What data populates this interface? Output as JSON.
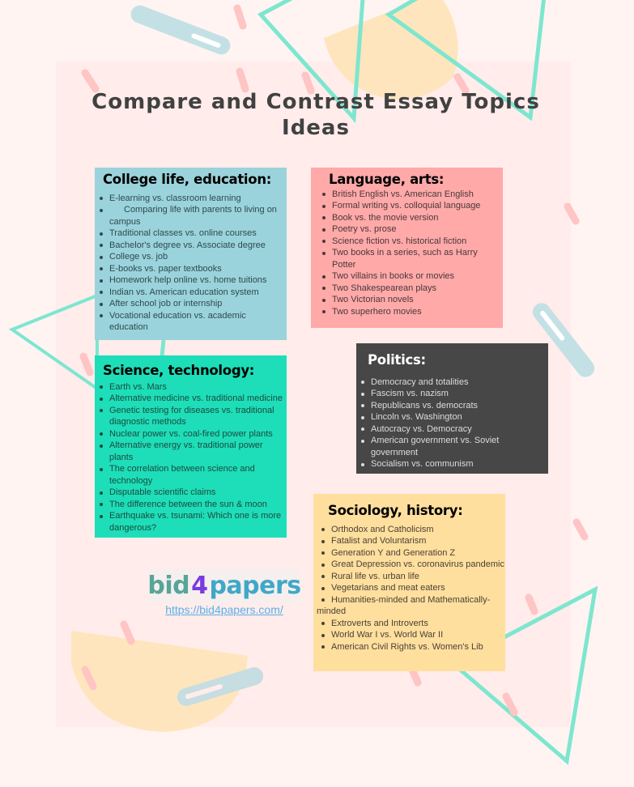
{
  "title": "Compare and Contrast Essay Topics Ideas",
  "colors": {
    "background": "#fff4f2",
    "panel": "#ffeceb",
    "college_card": "#9ad3db",
    "language_card": "#ffa9a9",
    "science_card": "#1ddeb8",
    "politics_card": "#474747",
    "sociology_card": "#ffdf9e",
    "accent_teal": "#7de6cf",
    "accent_pink": "#ffc4c4",
    "accent_yellow": "#ffe5bd",
    "accent_blue": "#c3e1e4"
  },
  "cards": {
    "college": {
      "heading": "College life, education:",
      "items": [
        "E-learning vs. classroom learning",
        "Comparing life with parents to living on campus",
        "Traditional classes vs. online courses",
        "Bachelor's degree vs. Associate degree",
        "College vs. job",
        "E-books vs. paper textbooks",
        "Homework help online vs. home tuitions",
        "Indian vs. American education system",
        "After school job or internship",
        "Vocational education vs. academic education"
      ]
    },
    "language": {
      "heading": "Language, arts:",
      "items": [
        "British English vs. American English",
        "Formal writing vs. colloquial language",
        "Book vs. the movie version",
        "Poetry vs. prose",
        "Science fiction vs. historical fiction",
        "Two books in a series, such as Harry Potter",
        "Two villains in books or movies",
        "Two Shakespearean plays",
        "Two Victorian novels",
        "Two superhero movies"
      ]
    },
    "science": {
      "heading": "Science, technology:",
      "items": [
        "Earth vs. Mars",
        "Alternative medicine vs. traditional medicine",
        "Genetic testing for diseases vs. traditional diagnostic methods",
        "Nuclear power vs. coal-fired power plants",
        "Alternative energy vs. traditional power plants",
        "The correlation between science and technology",
        "Disputable scientific claims",
        "The difference between the sun & moon",
        "Earthquake vs. tsunami: Which one is more dangerous?"
      ]
    },
    "politics": {
      "heading": "Politics:",
      "items": [
        "Democracy and totalities",
        "Fascism vs. nazism",
        "Republicans vs. democrats",
        "Lincoln vs. Washington",
        "Autocracy vs. Democracy",
        "American government vs. Soviet government",
        "Socialism vs. communism"
      ]
    },
    "sociology": {
      "heading": "Sociology, history:",
      "items": [
        "Orthodox and Catholicism",
        "Fatalist and Voluntarism",
        "Generation Y and Generation Z",
        "Great Depression vs. coronavirus pandemic",
        "Rural life vs. urban life",
        "Vegetarians and meat eaters",
        "Humanities-minded and Mathematically-minded",
        "Extroverts and Introverts",
        "World War I vs. World War II",
        "American Civil Rights vs. Women's Lib"
      ]
    }
  },
  "logo": {
    "part1": "bid",
    "part2": "4",
    "part3": "papers"
  },
  "link": "https://bid4papers.com/"
}
